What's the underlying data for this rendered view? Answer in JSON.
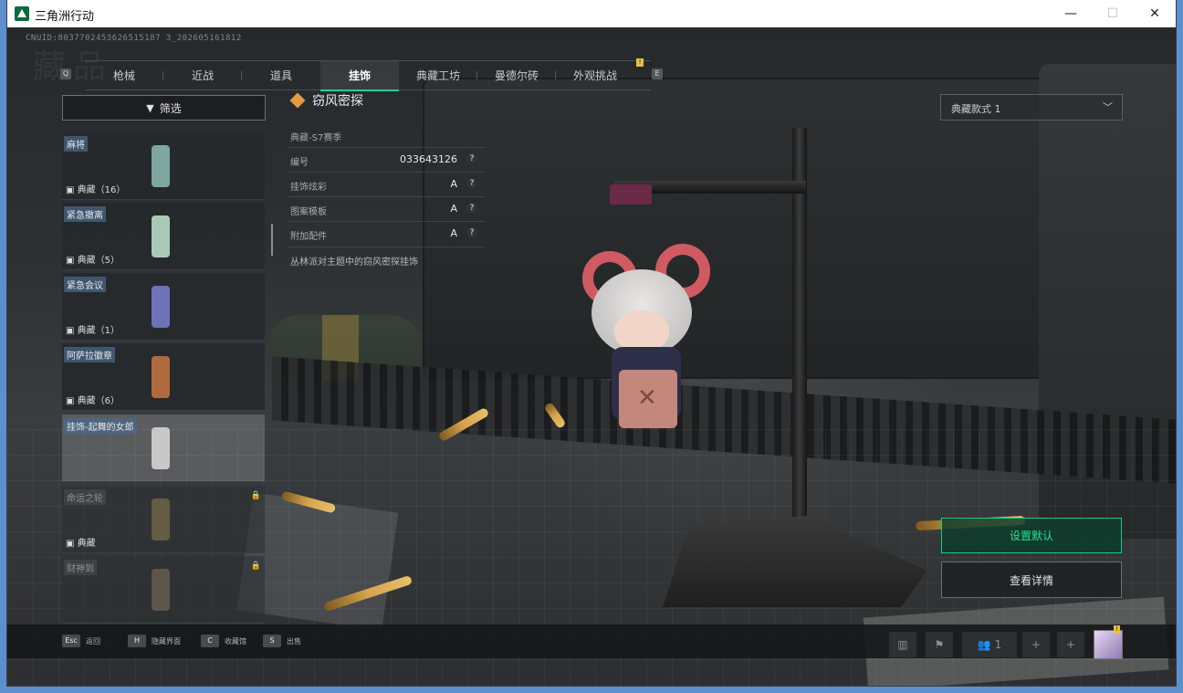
{
  "window": {
    "title": "三角洲行动",
    "minimize_icon": "minimize-icon",
    "maximize_icon": "maximize-icon",
    "close_icon": "close-icon"
  },
  "hud": {
    "uid": "CNUID:8037702453626515187 3_202605161812",
    "page_title": "藏品"
  },
  "tabs": {
    "left_key": "Q",
    "right_key": "E",
    "items": [
      {
        "label": "枪械"
      },
      {
        "label": "近战"
      },
      {
        "label": "道具"
      },
      {
        "label": "挂饰",
        "active": true
      },
      {
        "label": "典藏工坊"
      },
      {
        "label": "曼德尔砖"
      },
      {
        "label": "外观挑战",
        "badge": "!"
      }
    ]
  },
  "filter": {
    "label": "筛选",
    "icon": "filter-icon"
  },
  "collection": [
    {
      "name": "麻将",
      "count": "典藏（16）",
      "thumb_color": "#7fa6a0"
    },
    {
      "name": "紧急撤离",
      "count": "典藏（5）",
      "thumb_color": "#a9c9b8"
    },
    {
      "name": "紧急会议",
      "count": "典藏（1）",
      "thumb_color": "#6e72b8"
    },
    {
      "name": "阿萨拉徽章",
      "count": "典藏（6）",
      "thumb_color": "#b06a3e"
    },
    {
      "name": "挂饰-起舞的女郎",
      "count": "",
      "thumb_color": "#c8c8c8",
      "selected": true
    },
    {
      "name": "命运之轮",
      "count": "典藏",
      "thumb_color": "#9a8552",
      "locked": true
    },
    {
      "name": "财神到",
      "count": "",
      "thumb_color": "#8d7a62",
      "locked": true
    }
  ],
  "detail": {
    "name": "窃风密探",
    "season": "典藏-S7赛季",
    "attributes": [
      {
        "key": "编号",
        "value": "033643126"
      },
      {
        "key": "挂饰炫彩",
        "value": "A"
      },
      {
        "key": "图案模板",
        "value": "A"
      },
      {
        "key": "附加配件",
        "value": "A"
      }
    ],
    "help_symbol": "?",
    "description": "丛林派对主题中的窃风密探挂饰"
  },
  "style_select": {
    "value": "典藏款式 1"
  },
  "actions": {
    "set_default": "设置默认",
    "view_details": "查看详情"
  },
  "bottom_keys": [
    {
      "key": "Esc",
      "label": "返回"
    },
    {
      "key": "H",
      "label": "隐藏界面"
    },
    {
      "key": "C",
      "label": "收藏馆"
    },
    {
      "key": "S",
      "label": "出售"
    }
  ],
  "status_bar": {
    "party_count": "1",
    "avatar_badge": "!"
  },
  "colors": {
    "accent_green": "#1fd08c",
    "name_tag": "#4b698c",
    "diamond": "#e39b44"
  }
}
